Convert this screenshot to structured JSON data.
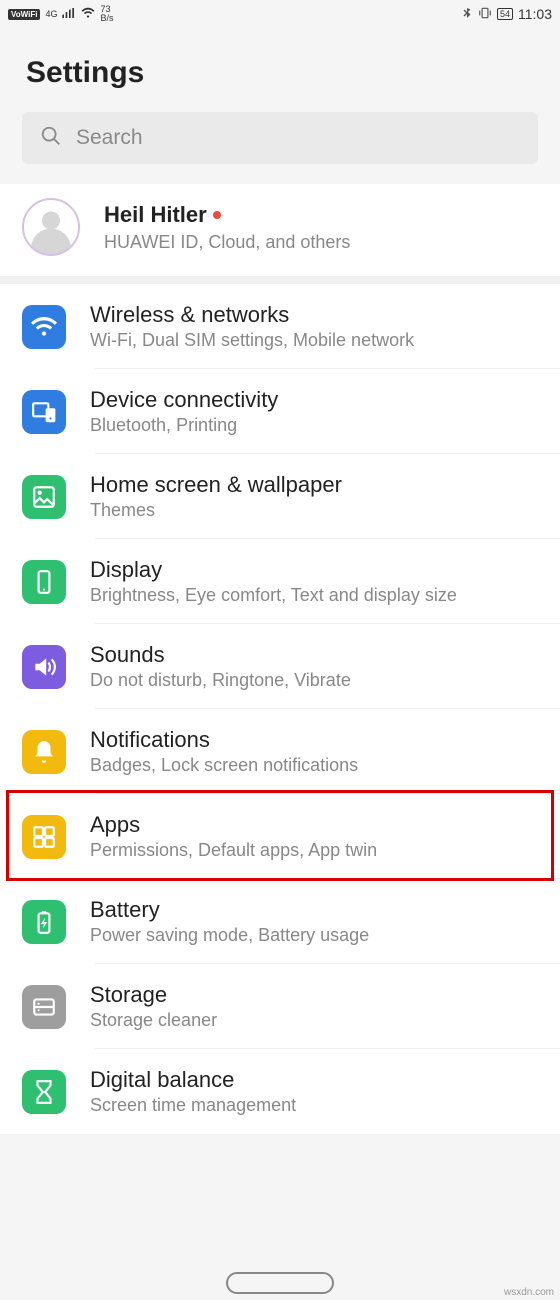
{
  "statusbar": {
    "vowifi": "VoWiFi",
    "net": "4G",
    "speed_value": "73",
    "speed_unit": "B/s",
    "battery": "54",
    "time": "11:03"
  },
  "header": {
    "title": "Settings"
  },
  "search": {
    "placeholder": "Search"
  },
  "account": {
    "name": "Heil Hitler",
    "subtitle": "HUAWEI ID, Cloud, and others"
  },
  "items": [
    {
      "icon": "wifi",
      "color": "#2f7de1",
      "title": "Wireless & networks",
      "subtitle": "Wi-Fi, Dual SIM settings, Mobile network"
    },
    {
      "icon": "devices",
      "color": "#2f7de1",
      "title": "Device connectivity",
      "subtitle": "Bluetooth, Printing"
    },
    {
      "icon": "image",
      "color": "#2fbf71",
      "title": "Home screen & wallpaper",
      "subtitle": "Themes"
    },
    {
      "icon": "phone",
      "color": "#2fbf71",
      "title": "Display",
      "subtitle": "Brightness, Eye comfort, Text and display size"
    },
    {
      "icon": "sound",
      "color": "#7d5ce0",
      "title": "Sounds",
      "subtitle": "Do not disturb, Ringtone, Vibrate"
    },
    {
      "icon": "bell",
      "color": "#f2b90f",
      "title": "Notifications",
      "subtitle": "Badges, Lock screen notifications"
    },
    {
      "icon": "grid",
      "color": "#f2b90f",
      "title": "Apps",
      "subtitle": "Permissions, Default apps, App twin",
      "highlight": true
    },
    {
      "icon": "battery",
      "color": "#2fbf71",
      "title": "Battery",
      "subtitle": "Power saving mode, Battery usage"
    },
    {
      "icon": "storage",
      "color": "#9e9e9e",
      "title": "Storage",
      "subtitle": "Storage cleaner"
    },
    {
      "icon": "hourglass",
      "color": "#2fbf71",
      "title": "Digital balance",
      "subtitle": "Screen time management"
    }
  ],
  "watermark": "wsxdn.com"
}
